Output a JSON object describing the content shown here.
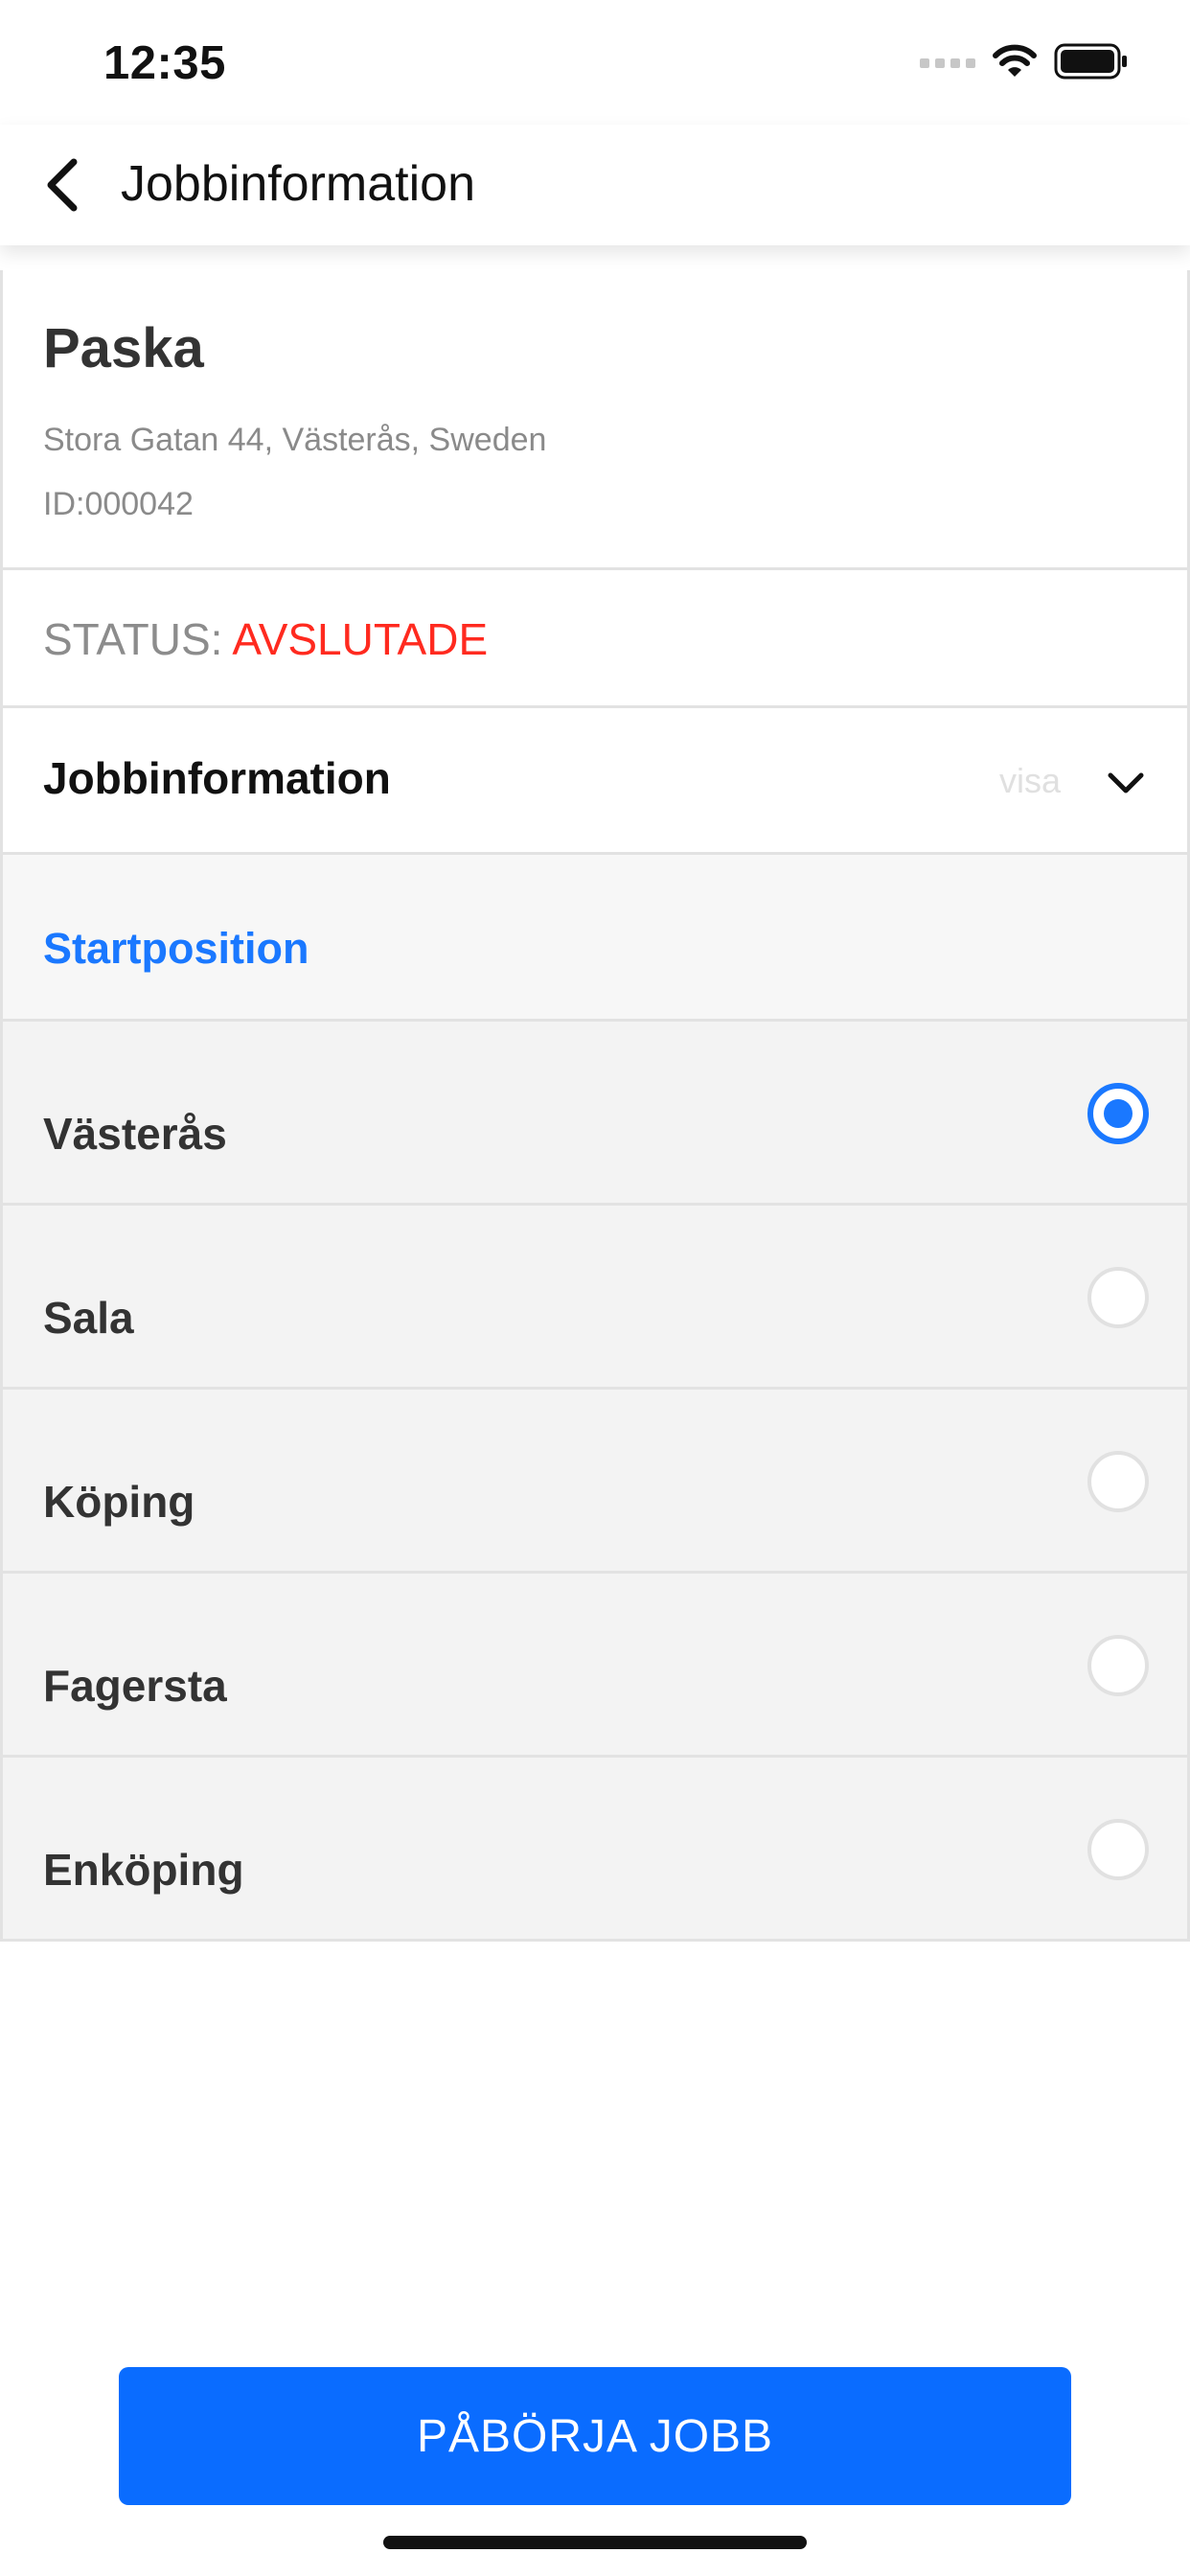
{
  "status_bar": {
    "time": "12:35",
    "icons": [
      "cellular-signal-icon",
      "wifi-icon",
      "battery-icon"
    ]
  },
  "nav": {
    "back_icon": "chevron-left-icon",
    "title": "Jobbinformation"
  },
  "job": {
    "name": "Paska",
    "address": "Stora Gatan 44, Västerås, Sweden",
    "id": "ID:000042"
  },
  "status": {
    "label": "STATUS:",
    "value": "AVSLUTADE",
    "value_color": "#ff2a1f"
  },
  "accordion": {
    "title": "Jobbinformation",
    "hint": "visa",
    "icon": "chevron-down-icon"
  },
  "start_position": {
    "heading": "Startposition",
    "options": [
      {
        "label": "Västerås",
        "selected": true
      },
      {
        "label": "Sala",
        "selected": false
      },
      {
        "label": "Köping",
        "selected": false
      },
      {
        "label": "Fagersta",
        "selected": false
      },
      {
        "label": "Enköping",
        "selected": false
      }
    ]
  },
  "actions": {
    "start_job_label": "PÅBÖRJA JOBB"
  },
  "colors": {
    "accent": "#1a78ff",
    "button": "#0a6cff",
    "status_red": "#ff2a1f"
  }
}
